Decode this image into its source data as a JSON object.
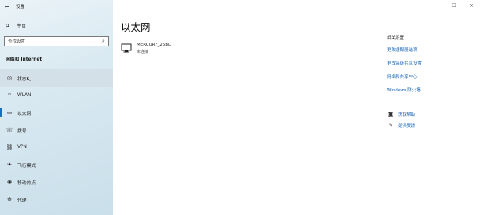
{
  "window": {
    "title": "设置",
    "back_icon": "back-arrow-icon",
    "controls": {
      "minimize": "—",
      "maximize": "☐",
      "close": "✕"
    }
  },
  "sidebar": {
    "home_label": "主页",
    "search_placeholder": "查找设置",
    "section_title": "网络和 Internet",
    "items": [
      {
        "label": "状态",
        "icon": "status-globe-icon",
        "glyph": "◎"
      },
      {
        "label": "WLAN",
        "icon": "wifi-icon",
        "glyph": "⌔"
      },
      {
        "label": "以太网",
        "icon": "ethernet-icon",
        "glyph": "▭"
      },
      {
        "label": "拨号",
        "icon": "dialup-phone-icon",
        "glyph": "☏"
      },
      {
        "label": "VPN",
        "icon": "vpn-icon",
        "glyph": "⛓"
      },
      {
        "label": "飞行模式",
        "icon": "airplane-icon",
        "glyph": "✈"
      },
      {
        "label": "移动热点",
        "icon": "hotspot-icon",
        "glyph": "◉"
      },
      {
        "label": "代理",
        "icon": "proxy-globe-icon",
        "glyph": "⊕"
      }
    ]
  },
  "main": {
    "page_title": "以太网",
    "network": {
      "name": "MERCURY_25BD",
      "status": "未连接"
    },
    "related": {
      "title": "相关设置",
      "links": [
        "更改适配器选项",
        "更改高级共享设置",
        "网络和共享中心",
        "Windows 防火墙"
      ]
    },
    "help": [
      {
        "label": "获取帮助",
        "icon": "help-chat-icon",
        "glyph": "◙"
      },
      {
        "label": "提供反馈",
        "icon": "feedback-icon",
        "glyph": "✎"
      }
    ]
  },
  "colors": {
    "accent": "#1a6fc0",
    "link": "#1565b8",
    "sidebar_bg": "#d8e8f1"
  }
}
